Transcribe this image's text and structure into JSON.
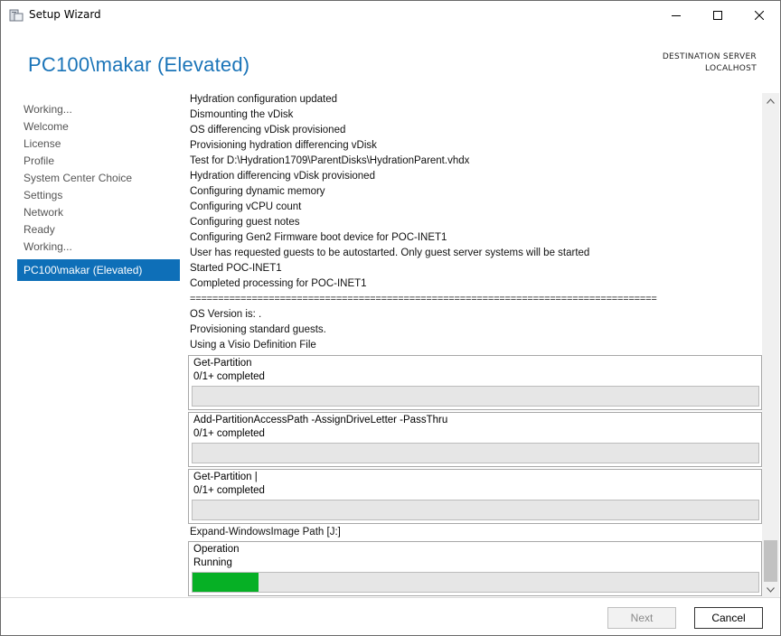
{
  "window": {
    "title": "Setup Wizard",
    "icon": "wizard-app-icon"
  },
  "header": {
    "title": "PC100\\makar (Elevated)",
    "dest_label": "DESTINATION SERVER",
    "dest_value": "LOCALHOST"
  },
  "nav": {
    "items": [
      "Working...",
      "Welcome",
      "License",
      "Profile",
      "System Center Choice",
      "Settings",
      "Network",
      "Ready",
      "Working..."
    ],
    "active": "PC100\\makar (Elevated)"
  },
  "log": {
    "lines": [
      "Hydration configuration updated",
      "Dismounting the vDisk",
      "OS differencing vDisk provisioned",
      "Provisioning hydration differencing vDisk",
      "Test for D:\\Hydration1709\\ParentDisks\\HydrationParent.vhdx",
      "Hydration differencing vDisk provisioned",
      "Configuring dynamic memory",
      "Configuring vCPU count",
      "Configuring guest notes",
      "Configuring Gen2 Firmware boot device for POC-INET1",
      "User has requested guests to be autostarted. Only guest server systems will be started",
      "Started POC-INET1",
      "Completed processing for POC-INET1",
      "===================================================================================",
      "OS Version is: .",
      "Provisioning standard guests.",
      "Using a Visio Definition File"
    ],
    "progress": [
      {
        "activity": "Get-Partition",
        "status": "0/1+ completed",
        "fraction": 0
      },
      {
        "activity": "Add-PartitionAccessPath -AssignDriveLetter -PassThru",
        "status": "0/1+ completed",
        "fraction": 0
      },
      {
        "activity": "Get-Partition |",
        "status": "0/1+ completed",
        "fraction": 0
      }
    ],
    "expand_line": "Expand-WindowsImage Path [J:]",
    "operation": {
      "activity": "Operation",
      "status": "Running",
      "fraction": 0.117
    }
  },
  "footer": {
    "next_label": "Next",
    "cancel_label": "Cancel"
  },
  "colors": {
    "accent": "#1a74b8",
    "nav_active": "#0e6fb8",
    "progress_fill": "#06b025"
  }
}
